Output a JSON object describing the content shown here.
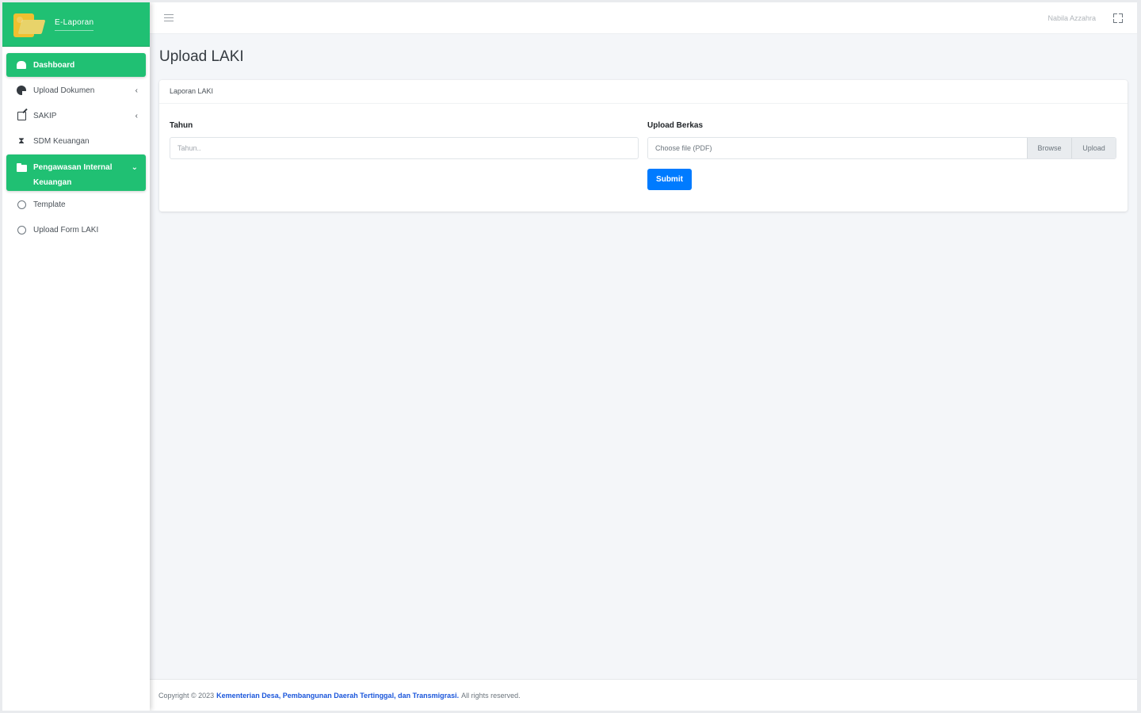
{
  "brand": {
    "name": "E-Laporan"
  },
  "sidebar": {
    "items": [
      {
        "label": "Dashboard",
        "icon": "home-icon"
      },
      {
        "label": "Upload Dokumen",
        "icon": "gauge-icon"
      },
      {
        "label": "SAKIP",
        "icon": "edit-icon"
      },
      {
        "label": "SDM Keuangan",
        "icon": "hourglass-icon"
      },
      {
        "label": "Pengawasan Internal Keuangan",
        "icon": "folder-icon"
      },
      {
        "label": "Template",
        "icon": "circle-icon"
      },
      {
        "label": "Upload Form LAKI",
        "icon": "circle-icon"
      }
    ],
    "caret_left": "‹",
    "caret_down": "⌄"
  },
  "topbar": {
    "user": "Nabila Azzahra"
  },
  "page": {
    "title": "Upload LAKI"
  },
  "card": {
    "header": "Laporan LAKI",
    "tahun_label": "Tahun",
    "tahun_placeholder": "Tahun..",
    "upload_label": "Upload Berkas",
    "file_placeholder": "Choose file (PDF)",
    "browse_label": "Browse",
    "upload_button": "Upload",
    "submit_label": "Submit"
  },
  "footer": {
    "prefix": "Copyright © 2023",
    "org": "Kementerian Desa, Pembangunan Daerah Tertinggal, dan Transmigrasi.",
    "suffix": "All rights reserved."
  },
  "colors": {
    "accent": "#20c073",
    "primary": "#007bff"
  }
}
